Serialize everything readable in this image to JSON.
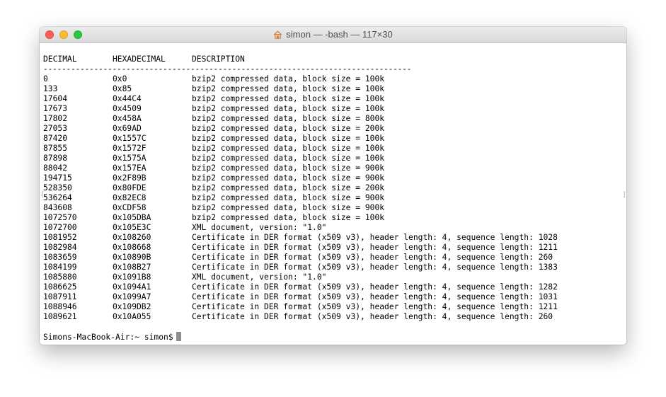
{
  "window": {
    "title": "simon — -bash — 117×30",
    "title_icon": "home-icon"
  },
  "table": {
    "headers": {
      "decimal": "DECIMAL",
      "hex": "HEXADECIMAL",
      "description": "DESCRIPTION"
    },
    "separator": "--------------------------------------------------------------------------------",
    "rows": [
      {
        "decimal": "0",
        "hex": "0x0",
        "description": "bzip2 compressed data, block size = 100k"
      },
      {
        "decimal": "133",
        "hex": "0x85",
        "description": "bzip2 compressed data, block size = 100k"
      },
      {
        "decimal": "17604",
        "hex": "0x44C4",
        "description": "bzip2 compressed data, block size = 100k"
      },
      {
        "decimal": "17673",
        "hex": "0x4509",
        "description": "bzip2 compressed data, block size = 100k"
      },
      {
        "decimal": "17802",
        "hex": "0x458A",
        "description": "bzip2 compressed data, block size = 800k"
      },
      {
        "decimal": "27053",
        "hex": "0x69AD",
        "description": "bzip2 compressed data, block size = 200k"
      },
      {
        "decimal": "87420",
        "hex": "0x1557C",
        "description": "bzip2 compressed data, block size = 100k"
      },
      {
        "decimal": "87855",
        "hex": "0x1572F",
        "description": "bzip2 compressed data, block size = 100k"
      },
      {
        "decimal": "87898",
        "hex": "0x1575A",
        "description": "bzip2 compressed data, block size = 100k"
      },
      {
        "decimal": "88042",
        "hex": "0x157EA",
        "description": "bzip2 compressed data, block size = 900k"
      },
      {
        "decimal": "194715",
        "hex": "0x2F89B",
        "description": "bzip2 compressed data, block size = 900k"
      },
      {
        "decimal": "528350",
        "hex": "0x80FDE",
        "description": "bzip2 compressed data, block size = 200k"
      },
      {
        "decimal": "536264",
        "hex": "0x82EC8",
        "description": "bzip2 compressed data, block size = 900k"
      },
      {
        "decimal": "843608",
        "hex": "0xCDF58",
        "description": "bzip2 compressed data, block size = 900k"
      },
      {
        "decimal": "1072570",
        "hex": "0x105DBA",
        "description": "bzip2 compressed data, block size = 100k"
      },
      {
        "decimal": "1072700",
        "hex": "0x105E3C",
        "description": "XML document, version: \"1.0\""
      },
      {
        "decimal": "1081952",
        "hex": "0x108260",
        "description": "Certificate in DER format (x509 v3), header length: 4, sequence length: 1028"
      },
      {
        "decimal": "1082984",
        "hex": "0x108668",
        "description": "Certificate in DER format (x509 v3), header length: 4, sequence length: 1211"
      },
      {
        "decimal": "1083659",
        "hex": "0x10890B",
        "description": "Certificate in DER format (x509 v3), header length: 4, sequence length: 260"
      },
      {
        "decimal": "1084199",
        "hex": "0x108B27",
        "description": "Certificate in DER format (x509 v3), header length: 4, sequence length: 1383"
      },
      {
        "decimal": "1085880",
        "hex": "0x1091B8",
        "description": "XML document, version: \"1.0\""
      },
      {
        "decimal": "1086625",
        "hex": "0x1094A1",
        "description": "Certificate in DER format (x509 v3), header length: 4, sequence length: 1282"
      },
      {
        "decimal": "1087911",
        "hex": "0x1099A7",
        "description": "Certificate in DER format (x509 v3), header length: 4, sequence length: 1031"
      },
      {
        "decimal": "1088946",
        "hex": "0x109DB2",
        "description": "Certificate in DER format (x509 v3), header length: 4, sequence length: 1211"
      },
      {
        "decimal": "1089621",
        "hex": "0x10A055",
        "description": "Certificate in DER format (x509 v3), header length: 4, sequence length: 260"
      }
    ]
  },
  "prompt": {
    "text": "Simons-MacBook-Air:~ simon$"
  },
  "colors": {
    "close": "#fc5f57",
    "minimize": "#fdbc2e",
    "maximize": "#28c840"
  }
}
